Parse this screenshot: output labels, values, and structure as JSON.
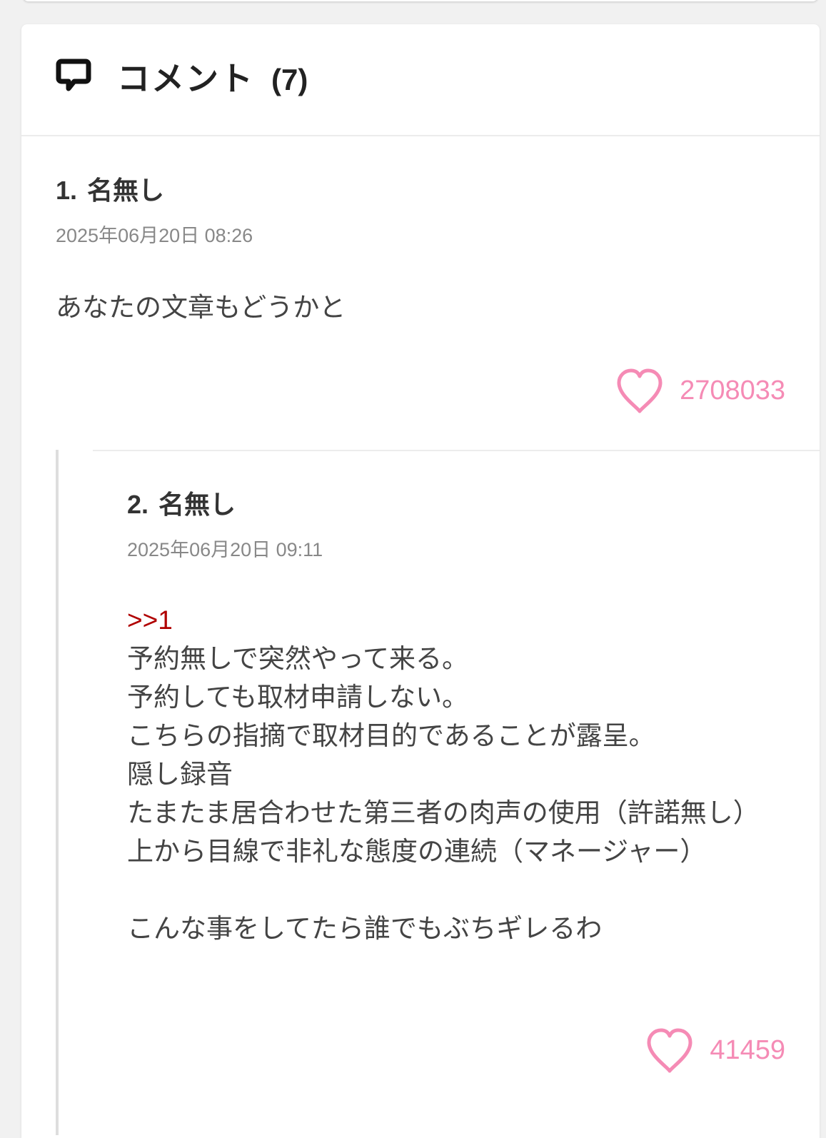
{
  "header": {
    "title": "コメント",
    "count": "(7)"
  },
  "comments": [
    {
      "number": "1.",
      "name": "名無し",
      "date": "2025年06月20日 08:26",
      "body": "あなたの文章もどうかと",
      "likes": "2708033"
    },
    {
      "number": "2.",
      "name": "名無し",
      "date": "2025年06月20日 09:11",
      "anchor": ">>1",
      "body_lines": [
        "予約無しで突然やって来る。",
        "予約しても取材申請しない。",
        "こちらの指摘で取材目的であることが露呈。",
        "隠し録音",
        "たまたま居合わせた第三者の肉声の使用（許諾無し）",
        "上から目線で非礼な態度の連続（マネージャー）",
        "",
        "こんな事をしてたら誰でもぶちギレるわ"
      ],
      "likes": "41459"
    }
  ],
  "colors": {
    "like": "#f58bb5",
    "anchor": "#b00000"
  },
  "icons": {
    "header": "comment-bubble-icon",
    "like": "heart-outline-icon"
  }
}
